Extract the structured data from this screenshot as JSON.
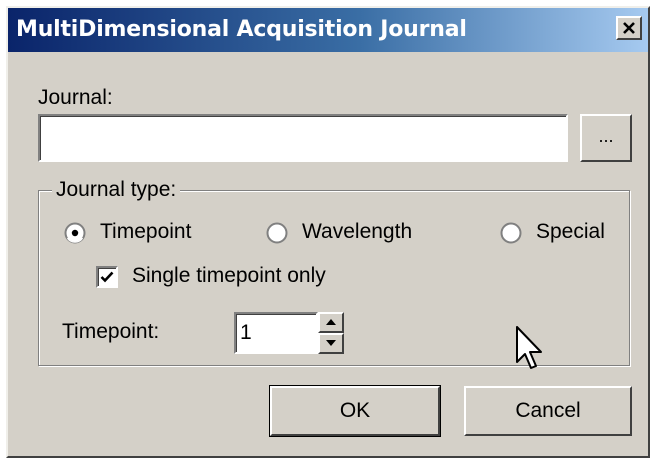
{
  "window": {
    "title": "MultiDimensional Acquisition Journal",
    "close_icon": "close-icon"
  },
  "journal": {
    "label": "Journal:",
    "value": "",
    "browse_label": "..."
  },
  "journal_type": {
    "legend": "Journal type:",
    "options": [
      {
        "label": "Timepoint",
        "selected": true
      },
      {
        "label": "Wavelength",
        "selected": false
      },
      {
        "label": "Special",
        "selected": false
      }
    ],
    "single_timepoint": {
      "label": "Single timepoint only",
      "checked": true
    },
    "timepoint": {
      "label": "Timepoint:",
      "value": "1"
    }
  },
  "buttons": {
    "ok": "OK",
    "cancel": "Cancel"
  },
  "colors": {
    "face": "#d4d0c8",
    "title_start": "#0a246a",
    "title_end": "#a6caf0"
  }
}
